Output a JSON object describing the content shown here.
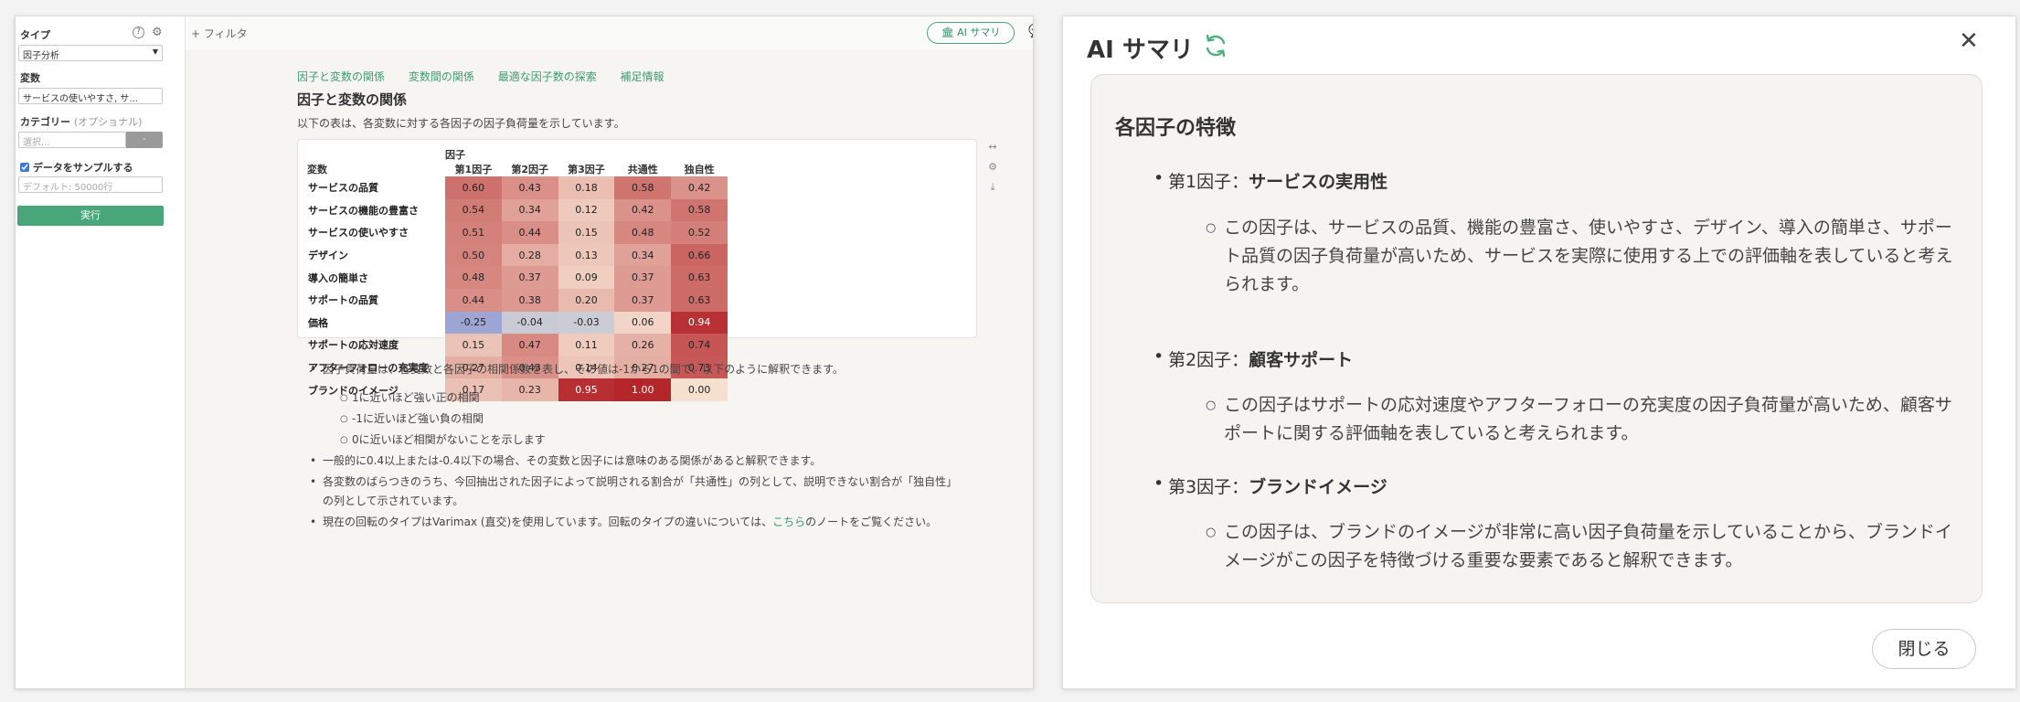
{
  "sidebar": {
    "type_label": "タイプ",
    "help_glyph": "?",
    "type_value": "因子分析",
    "variables_label": "変数",
    "variables_value": "サービスの使いやすさ, サ...",
    "category_label": "カテゴリー",
    "category_optional": "(オプショナル)",
    "category_placeholder": "選択...",
    "category_btn": "-",
    "sample_label": "データをサンプルする",
    "sample_checked": true,
    "sample_placeholder": "デフォルト: 50000行",
    "run_label": "実行"
  },
  "topbar": {
    "filter_label": "+ フィルタ",
    "ai_summary_label": "AI サマリ"
  },
  "content": {
    "tabs": [
      "因子と変数の関係",
      "変数間の関係",
      "最適な因子数の探索",
      "補足情報"
    ],
    "title": "因子と変数の関係",
    "description": "以下の表は、各変数に対する各因子の因子負荷量を示しています。",
    "table": {
      "group_header": "因子",
      "var_header": "変数",
      "columns": [
        "第1因子",
        "第2因子",
        "第3因子",
        "共通性",
        "独自性"
      ],
      "rows": [
        {
          "name": "サービスの品質",
          "values": [
            "0.60",
            "0.43",
            "0.18",
            "0.58",
            "0.42"
          ]
        },
        {
          "name": "サービスの機能の豊富さ",
          "values": [
            "0.54",
            "0.34",
            "0.12",
            "0.42",
            "0.58"
          ]
        },
        {
          "name": "サービスの使いやすさ",
          "values": [
            "0.51",
            "0.44",
            "0.15",
            "0.48",
            "0.52"
          ]
        },
        {
          "name": "デザイン",
          "values": [
            "0.50",
            "0.28",
            "0.13",
            "0.34",
            "0.66"
          ]
        },
        {
          "name": "導入の簡単さ",
          "values": [
            "0.48",
            "0.37",
            "0.09",
            "0.37",
            "0.63"
          ]
        },
        {
          "name": "サポートの品質",
          "values": [
            "0.44",
            "0.38",
            "0.20",
            "0.37",
            "0.63"
          ]
        },
        {
          "name": "価格",
          "values": [
            "-0.25",
            "-0.04",
            "-0.03",
            "0.06",
            "0.94"
          ]
        },
        {
          "name": "サポートの応対速度",
          "values": [
            "0.15",
            "0.47",
            "0.11",
            "0.26",
            "0.74"
          ]
        },
        {
          "name": "アフターフォローの充実度",
          "values": [
            "0.27",
            "0.43",
            "0.14",
            "0.27",
            "0.73"
          ]
        },
        {
          "name": "ブランドのイメージ",
          "values": [
            "0.17",
            "0.23",
            "0.95",
            "1.00",
            "0.00"
          ]
        }
      ],
      "tools": [
        "↔",
        "⚙",
        "⤓"
      ]
    },
    "notes": {
      "bullet1": "因子負荷量は、各変数と各因子の相関係数を表し、その値は-1から1の間で、以下のように解釈できます。",
      "sub1": "1に近いほど強い正の相関",
      "sub2": "-1に近いほど強い負の相関",
      "sub3": "0に近いほど相関がないことを示します",
      "bullet2": "一般的に0.4以上または-0.4以下の場合、その変数と因子には意味のある関係があると解釈できます。",
      "bullet3": "各変数のばらつきのうち、今回抽出された因子によって説明される割合が「共通性」の列として、説明できない割合が「独自性」の列として示されています。",
      "bullet4_pre": "現在の回転のタイプはVarimax (直交)を使用しています。回転のタイプの違いについては、",
      "bullet4_link": "こちら",
      "bullet4_post": "のノートをご覧ください。"
    }
  },
  "ai_panel": {
    "title": "AI サマリ",
    "close_glyph": "✕",
    "heading": "各因子の特徴",
    "factors": [
      {
        "prefix": "第1因子：",
        "name": "サービスの実用性",
        "desc": "この因子は、サービスの品質、機能の豊富さ、使いやすさ、デザイン、導入の簡単さ、サポート品質の因子負荷量が高いため、サービスを実際に使用する上での評価軸を表していると考えられます。"
      },
      {
        "prefix": "第2因子：",
        "name": "顧客サポート",
        "desc": "この因子はサポートの応対速度やアフターフォローの充実度の因子負荷量が高いため、顧客サポートに関する評価軸を表していると考えられます。"
      },
      {
        "prefix": "第3因子：",
        "name": "ブランドイメージ",
        "desc": "この因子は、ブランドのイメージが非常に高い因子負荷量を示していることから、ブランドイメージがこの因子を特徴づける重要な要素であると解釈できます。"
      }
    ],
    "close_button": "閉じる"
  },
  "colors": {
    "accent": "#48a67a",
    "link": "#3f9b6e",
    "heat_high": "#b4262a",
    "heat_low": "#8b96d4"
  }
}
